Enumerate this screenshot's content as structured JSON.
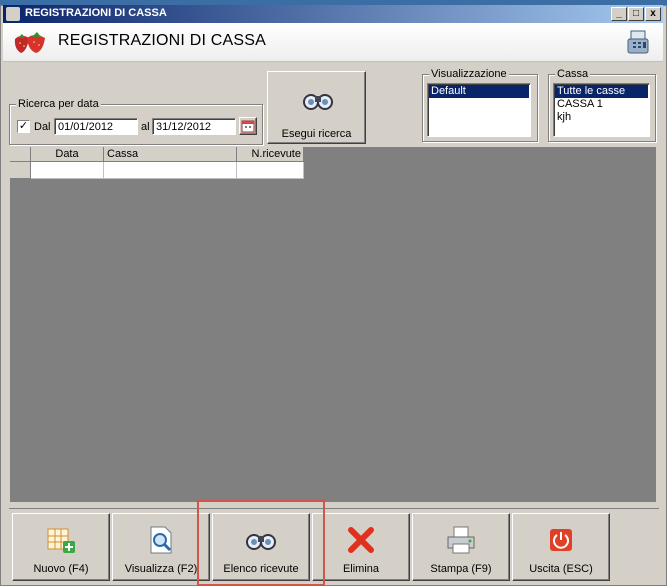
{
  "window": {
    "title": "REGISTRAZIONI DI CASSA",
    "header_title": "REGISTRAZIONI DI CASSA",
    "minimize": "_",
    "maximize": "□",
    "close": "x"
  },
  "search": {
    "group_label": "Ricerca per data",
    "from_checked": true,
    "from_label": "Dal",
    "from_value": "01/01/2012",
    "to_label": "al",
    "to_value": "31/12/2012",
    "execute_label": "Esegui ricerca"
  },
  "visualizzazione": {
    "group_label": "Visualizzazione",
    "items": [
      "Default"
    ],
    "selected_index": 0
  },
  "cassa": {
    "group_label": "Cassa",
    "items": [
      "Tutte le casse",
      "CASSA 1",
      "kjh"
    ],
    "selected_index": 0
  },
  "grid": {
    "columns": [
      "Data",
      "Cassa",
      "N.ricevute"
    ],
    "rows": [
      [
        "",
        "",
        ""
      ]
    ]
  },
  "buttons": [
    {
      "label": "Nuovo (F4)",
      "icon": "add-grid-icon"
    },
    {
      "label": "Visualizza (F2)",
      "icon": "view-document-icon"
    },
    {
      "label": "Elenco ricevute",
      "icon": "binoculars-icon"
    },
    {
      "label": "Elimina",
      "icon": "delete-x-icon"
    },
    {
      "label": "Stampa (F9)",
      "icon": "printer-icon"
    },
    {
      "label": "Uscita (ESC)",
      "icon": "power-exit-icon"
    }
  ],
  "colors": {
    "titlebar_start": "#0a246a",
    "titlebar_end": "#a6caf0",
    "grid_background": "#808080",
    "highlight": "#d0554a"
  }
}
